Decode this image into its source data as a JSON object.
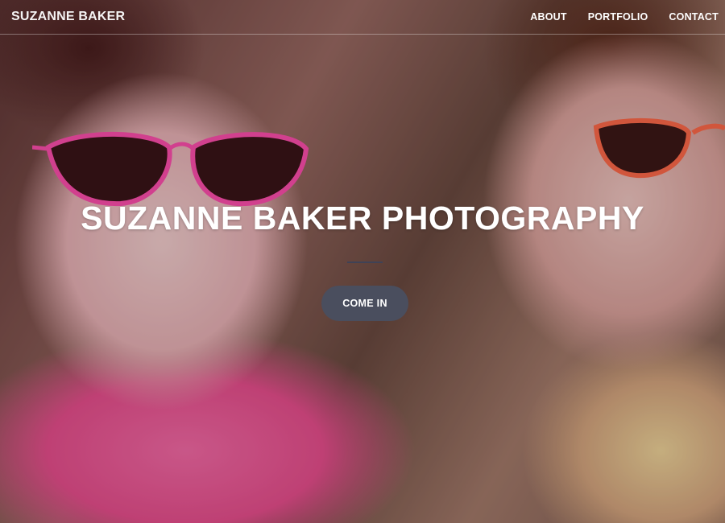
{
  "nav": {
    "brand": "SUZANNE BAKER",
    "links": [
      "ABOUT",
      "PORTFOLIO",
      "CONTACT"
    ]
  },
  "hero": {
    "headline": "SUZANNE BAKER PHOTOGRAPHY",
    "cta_label": "COME IN",
    "image": "photo-two-girls-sunglasses"
  },
  "colors": {
    "button_bg": "#4a4e5e",
    "divider": "#3f4256",
    "text": "#ffffff"
  }
}
